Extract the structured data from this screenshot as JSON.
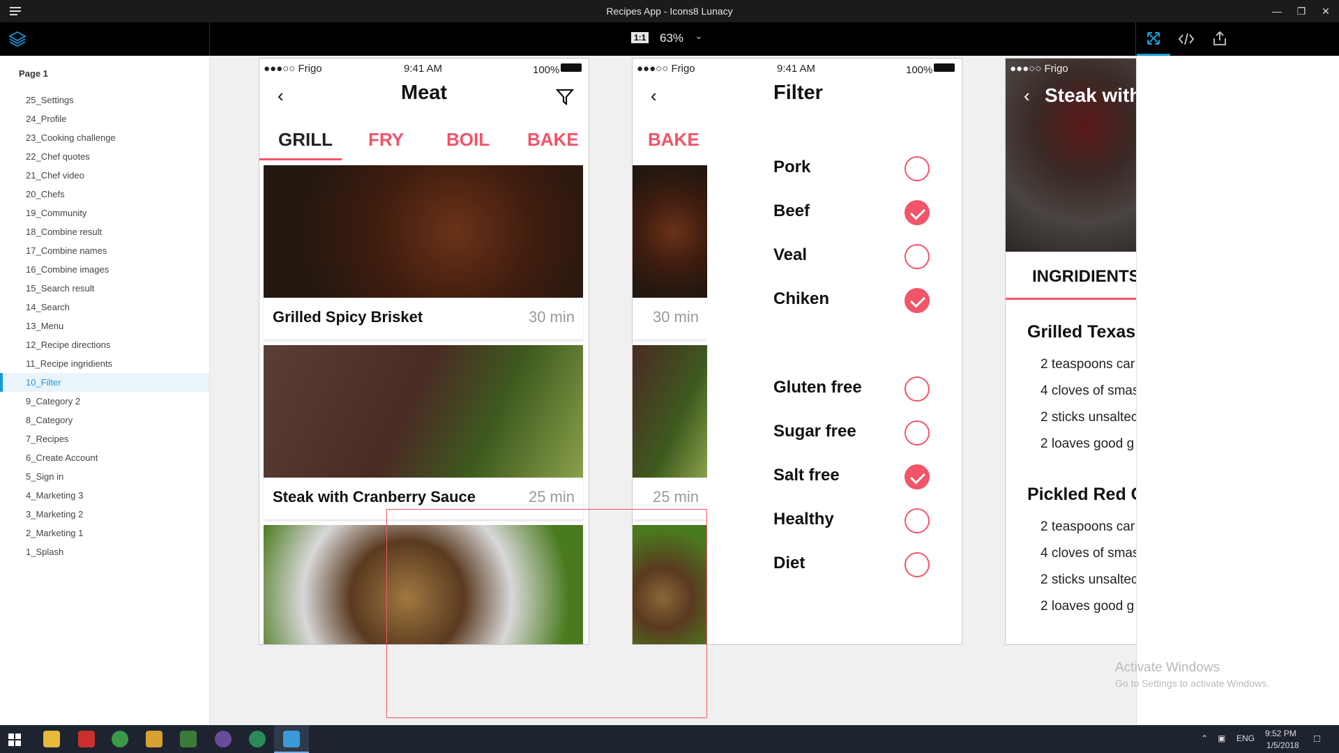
{
  "window": {
    "title": "Recipes App - Icons8 Lunacy"
  },
  "toolbar": {
    "actual_size_label": "1:1",
    "zoom": "63%"
  },
  "layers": {
    "page_label": "Page 1",
    "selected": "10_Filter",
    "items": [
      "25_Settings",
      "24_Profile",
      "23_Cooking challenge",
      "22_Chef quotes",
      "21_Chef video",
      "20_Chefs",
      "19_Community",
      "18_Combine result",
      "17_Combine names",
      "16_Combine images",
      "15_Search result",
      "14_Search",
      "13_Menu",
      "12_Recipe directions",
      "11_Recipe ingridients",
      "10_Filter",
      "9_Category 2",
      "8_Category",
      "7_Recipes",
      "6_Create Account",
      "5_Sign in",
      "4_Marketing 3",
      "3_Marketing 2",
      "2_Marketing 1",
      "1_Splash"
    ]
  },
  "status_bar": {
    "carrier": "●●●○○ Frigo",
    "time": "9:41 AM",
    "battery": "100%"
  },
  "meat_screen": {
    "title": "Meat",
    "tabs": [
      "GRILL",
      "FRY",
      "BOIL",
      "BAKE"
    ],
    "cards": [
      {
        "title": "Grilled Spicy Brisket",
        "time": "30 min"
      },
      {
        "title": "Steak with Cranberry Sauce",
        "time": "25 min"
      },
      {
        "title": "",
        "time": ""
      }
    ]
  },
  "filter_screen": {
    "title": "Filter",
    "background_tab": "BAKE",
    "background_times": [
      "30 min",
      "25 min"
    ],
    "options": [
      {
        "label": "Pork",
        "checked": false
      },
      {
        "label": "Beef",
        "checked": true
      },
      {
        "label": "Veal",
        "checked": false
      },
      {
        "label": "Chiken",
        "checked": true
      },
      {
        "label": "Gluten free",
        "checked": false
      },
      {
        "label": "Sugar free",
        "checked": false
      },
      {
        "label": "Salt free",
        "checked": true
      },
      {
        "label": "Healthy",
        "checked": false
      },
      {
        "label": "Diet",
        "checked": false
      }
    ]
  },
  "recipe_screen": {
    "carrier": "●●●○○ Frigo",
    "title": "Steak with",
    "tab": "INGRIDIENTS",
    "sections": [
      {
        "title": "Grilled Texas",
        "items": [
          "2 teaspoons car",
          "4 cloves of smas",
          "2 sticks unsaltec",
          "2 loaves good g"
        ]
      },
      {
        "title": "Pickled Red C",
        "items": [
          "2 teaspoons car",
          "4 cloves of smas",
          "2 sticks unsaltec",
          "2 loaves good g"
        ]
      }
    ]
  },
  "watermark": {
    "line1": "Activate Windows",
    "line2": "Go to Settings to activate Windows."
  },
  "taskbar": {
    "language": "ENG",
    "time": "9:52 PM",
    "date": "1/5/2018"
  },
  "colors": {
    "accent": "#f2546a",
    "selection": "#1a9bd8"
  }
}
